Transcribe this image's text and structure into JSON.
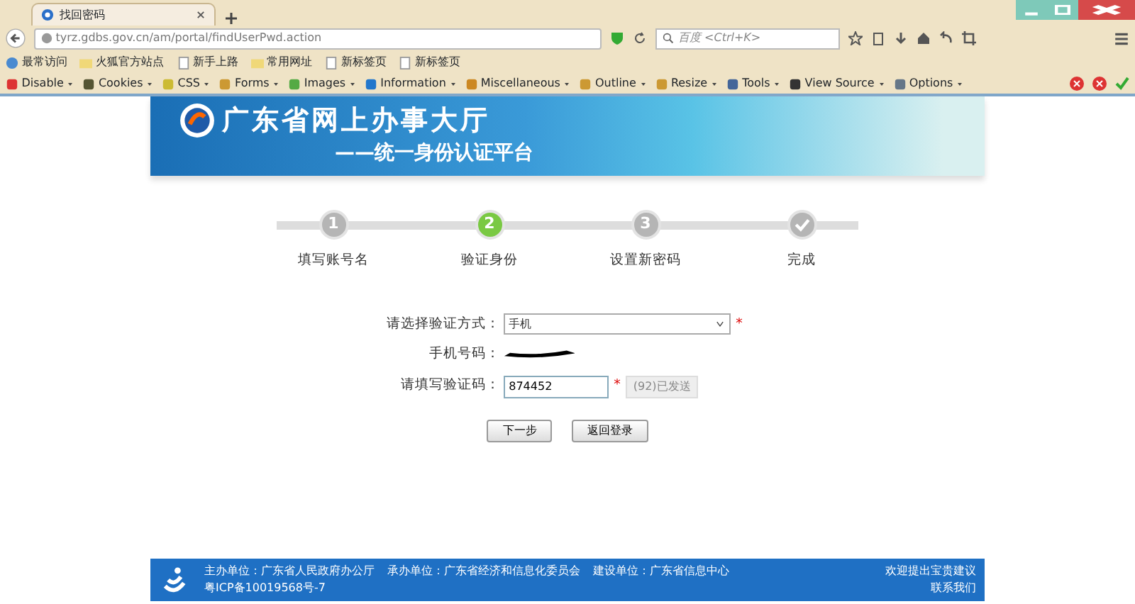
{
  "browser": {
    "tab_title": "找回密码",
    "url": "tyrz.gdbs.gov.cn/am/portal/findUserPwd.action",
    "search_placeholder": "百度 <Ctrl+K>",
    "bookmarks": [
      {
        "label": "最常访问",
        "kind": "globe"
      },
      {
        "label": "火狐官方站点",
        "kind": "folder"
      },
      {
        "label": "新手上路",
        "kind": "page"
      },
      {
        "label": "常用网址",
        "kind": "folder"
      },
      {
        "label": "新标签页",
        "kind": "page"
      },
      {
        "label": "新标签页",
        "kind": "page"
      }
    ],
    "toolbar": [
      "Disable",
      "Cookies",
      "CSS",
      "Forms",
      "Images",
      "Information",
      "Miscellaneous",
      "Outline",
      "Resize",
      "Tools",
      "View Source",
      "Options"
    ]
  },
  "banner": {
    "title": "广东省网上办事大厅",
    "subtitle": "——统一身份认证平台"
  },
  "steps": [
    {
      "number": "1",
      "label": "填写账号名",
      "selected": false,
      "kind": "number"
    },
    {
      "number": "2",
      "label": "验证身份",
      "selected": true,
      "kind": "number"
    },
    {
      "number": "3",
      "label": "设置新密码",
      "selected": false,
      "kind": "number"
    },
    {
      "label": "完成",
      "selected": false,
      "kind": "check"
    }
  ],
  "form": {
    "method_label": "请选择验证方式：",
    "method_value": "手机",
    "method_required": "*",
    "code_required": "*",
    "phone_label": "手机号码：",
    "code_label": "请填写验证码：",
    "code_value": "874452",
    "resend_button": "(92)已发送",
    "resend_disabled": true,
    "next_button": "下一步",
    "back_button": "返回登录"
  },
  "footer": {
    "sponsor": "主办单位：广东省人民政府办公厅",
    "organizer": "承办单位：广东省经济和信息化委员会",
    "builder": "建设单位：广东省信息中心",
    "icp": "粤ICP备10019568号-7",
    "feedback": "欢迎提出宝贵建议",
    "contact": "联系我们"
  }
}
